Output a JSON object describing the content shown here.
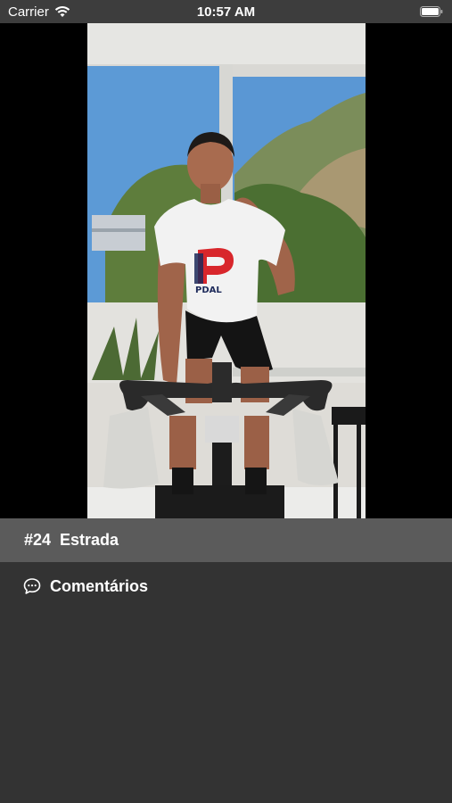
{
  "status_bar": {
    "carrier": "Carrier",
    "time": "10:57 AM",
    "icons": [
      "wifi-icon",
      "battery-icon"
    ]
  },
  "video": {
    "shirt_logo_text": "PDAL"
  },
  "workout": {
    "title": "#24  Estrada"
  },
  "comments": {
    "icon": "speech-bubble-icon",
    "label": "Comentários"
  },
  "colors": {
    "background": "#333333",
    "title_bar": "#5b5b5b",
    "status_bar": "#3d3d3d",
    "logo_red": "#d8262b",
    "logo_navy": "#1d2a5a"
  }
}
